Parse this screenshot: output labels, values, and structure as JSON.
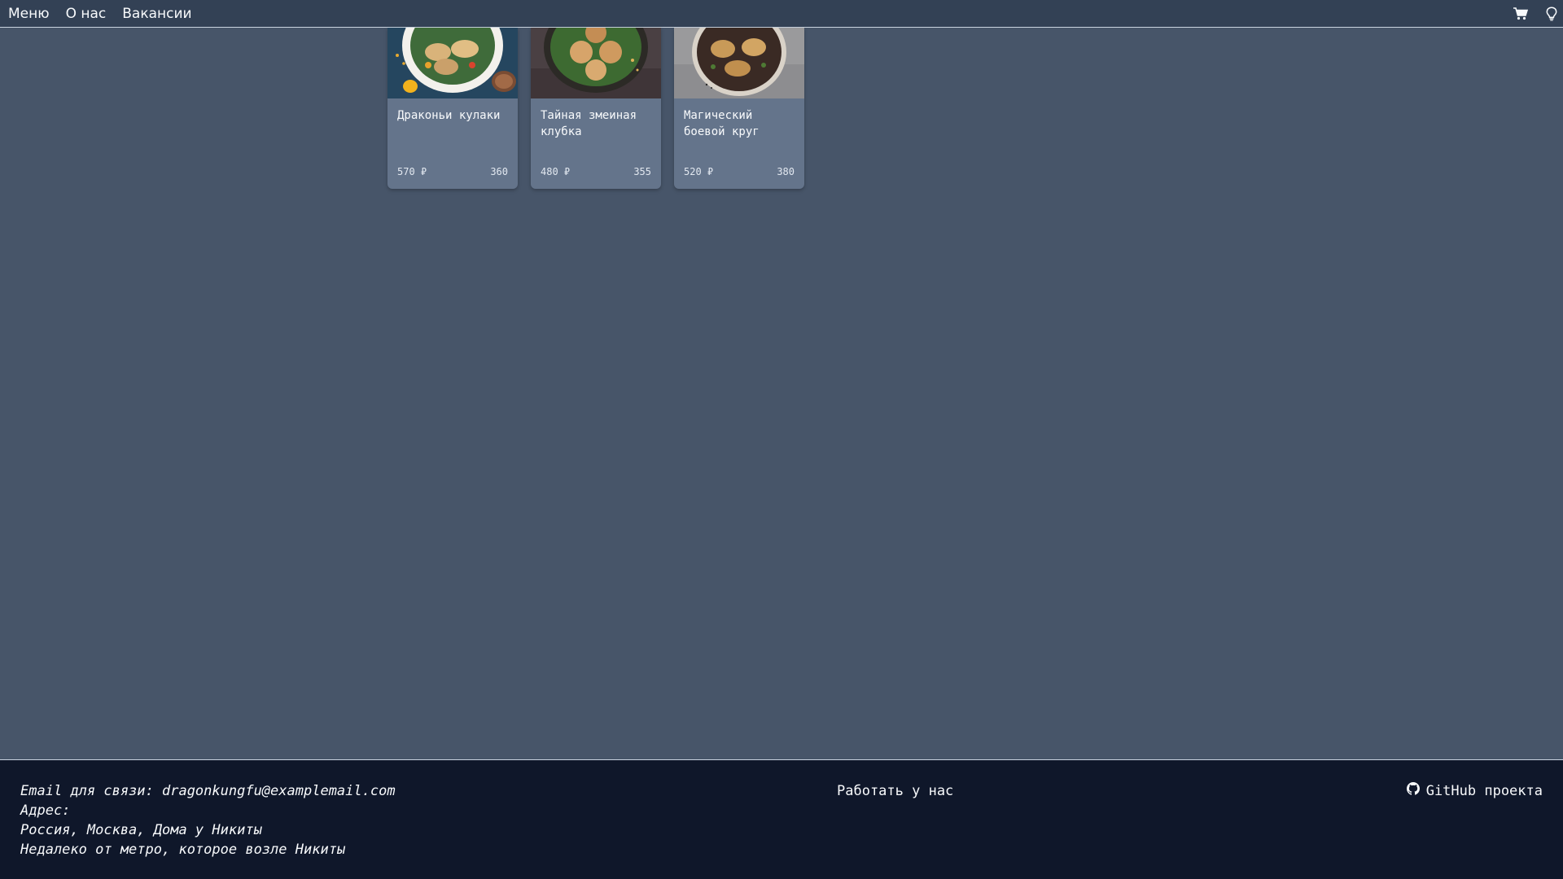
{
  "nav": {
    "links": [
      {
        "label": "Меню"
      },
      {
        "label": "О нас"
      },
      {
        "label": "Вакансии"
      }
    ],
    "icons": [
      "cart-icon",
      "lightbulb-icon"
    ]
  },
  "cards": [
    {
      "title": "Драконьи кулаки",
      "price": "570 ₽",
      "weight": "360",
      "image": "dumplings-bowl-blue"
    },
    {
      "title": "Тайная змеиная клубка",
      "price": "480 ₽",
      "weight": "355",
      "image": "dumplings-bowl-dark"
    },
    {
      "title": "Магический боевой круг",
      "price": "520 ₽",
      "weight": "380",
      "image": "dumplings-bowl-grey"
    }
  ],
  "footer": {
    "email_line": "Email для связи: dragonkungfu@examplemail.com",
    "address_label": "Адрес:",
    "address_line1": "Россия, Москва, Дома у Никиты",
    "address_line2": "Недалеко от метро, которое возле Никиты",
    "work_link": "Работать у нас",
    "github_link": "GitHub проекта",
    "github_icon": "github-icon"
  },
  "colors": {
    "page_bg": "#475569",
    "topbar_bg": "#334155",
    "card_bg": "#64748b",
    "footer_bg": "#0f172a",
    "text": "#f8fafc"
  }
}
